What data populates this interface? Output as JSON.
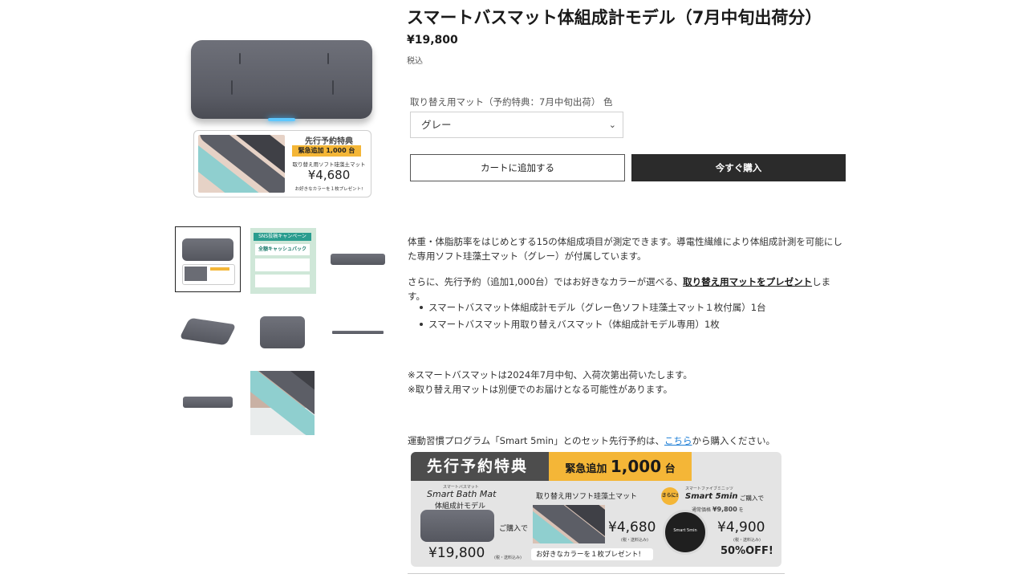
{
  "product": {
    "title": "スマートバスマット体組成計モデル（7月中旬出荷分）",
    "price": "¥19,800",
    "tax_note": "税込"
  },
  "gallery": {
    "promo_card": {
      "title": "先行予約特典",
      "badge": "緊急追加 1,000 台",
      "subtitle": "取り替え用ソフト珪藻土マット",
      "price": "¥4,680",
      "note": "お好きなカラーを１枚プレゼント!"
    },
    "thumb_sns_title": "SNS投稿キャンペーン",
    "thumb_sns_sub": "全額キャッシュバック"
  },
  "options": {
    "label": "取り替え用マット（予約特典：7月中旬出荷） 色",
    "selected": "グレー"
  },
  "buttons": {
    "add_to_cart": "カートに追加する",
    "buy_now": "今すぐ購入"
  },
  "description": {
    "p1": "体重・体脂肪率をはじめとする15の体組成項目が測定できます。導電性繊維により体組成計測を可能にした専用ソフト珪藻土マット（グレー）が付属しています。",
    "p2_before": "さらに、先行予約（追加1,000台）ではお好きなカラーが選べる、",
    "p2_link": "取り替え用マットをプレゼント",
    "p2_after": "します。",
    "bullets": [
      "スマートバスマット体組成計モデル（グレー色ソフト珪藻土マット１枚付属）1台",
      "スマートバスマット用取り替えバスマット（体組成計モデル専用）1枚"
    ],
    "note1": "※スマートバスマットは2024年7月中旬、入荷次第出荷いたします。",
    "note2": "※取り替え用マットは別便でのお届けとなる可能性があります。",
    "p3_before": "運動習慣プログラム「Smart 5min」とのセット先行予約は、",
    "p3_link": "こちら",
    "p3_after": "から購入ください。"
  },
  "banner": {
    "head": "先行予約特典",
    "urgent_prefix": "緊急追加",
    "urgent_count": "1,000",
    "urgent_suffix": "台",
    "brand": "Smart Bath Mat",
    "brand_kana": "スマートバスマット",
    "model": "体組成計モデル",
    "purchase": "ご購入で",
    "price_main": "¥19,800",
    "price_main_tax": "(税・送料込み)",
    "mat_label": "取り替え用ソフト珪藻土マット",
    "mat_price": "¥4,680",
    "mat_tax": "(税・送料込み)",
    "mat_note": "お好きなカラーを１枚プレゼント!",
    "sarani": "さらに!",
    "s5_kana": "スマートファイブミニッツ",
    "s5_name": "Smart 5min",
    "s5_purchase": "ご購入で",
    "regular_label": "通常価格",
    "regular_price": "¥9,800",
    "regular_suffix": "を",
    "s5_price": "¥4,900",
    "s5_tax": "(税・送料込み)",
    "off": "50%OFF!",
    "device_label": "Smart 5min"
  },
  "colors": {
    "mat_gray": "#5f616a",
    "accent_orange": "#f4b637",
    "buy_button": "#2b2b2b",
    "link_blue": "#1f7fd6",
    "led_blue": "#5ec8ff"
  }
}
